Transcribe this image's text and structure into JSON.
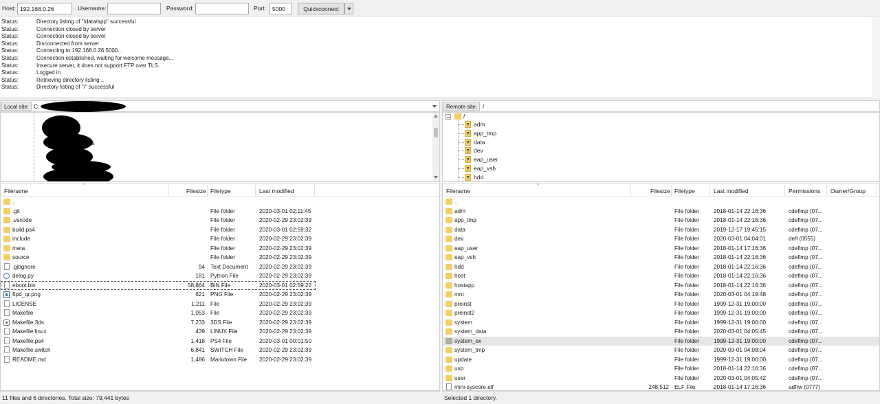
{
  "quickconnect": {
    "host_label": "Host:",
    "host_value": "192.168.0.26",
    "username_label": "Username:",
    "username_value": "",
    "password_label": "Password:",
    "password_value": "",
    "port_label": "Port:",
    "port_value": "5000",
    "button_label": "Quickconnect"
  },
  "log": [
    {
      "kind": "Status:",
      "msg": "Directory listing of \"/data/app\" successful"
    },
    {
      "kind": "Status:",
      "msg": "Connection closed by server"
    },
    {
      "kind": "Status:",
      "msg": "Connection closed by server"
    },
    {
      "kind": "Status:",
      "msg": "Disconnected from server"
    },
    {
      "kind": "Status:",
      "msg": "Connecting to 192.168.0.26:5000..."
    },
    {
      "kind": "Status:",
      "msg": "Connection established, waiting for welcome message..."
    },
    {
      "kind": "Status:",
      "msg": "Insecure server, it does not support FTP over TLS."
    },
    {
      "kind": "Status:",
      "msg": "Logged in"
    },
    {
      "kind": "Status:",
      "msg": "Retrieving directory listing..."
    },
    {
      "kind": "Status:",
      "msg": "Directory listing of \"/\" successful"
    }
  ],
  "local": {
    "site_label": "Local site:",
    "site_path": "C:",
    "tree_visible_text": "a",
    "columns": {
      "filename": "Filename",
      "filesize": "Filesize",
      "filetype": "Filetype",
      "modified": "Last modified"
    },
    "files": [
      {
        "name": "..",
        "size": "",
        "type": "",
        "modified": "",
        "icon": "folder"
      },
      {
        "name": ".git",
        "size": "",
        "type": "File folder",
        "modified": "2020-03-01 02:11:45",
        "icon": "folder"
      },
      {
        "name": ".vscode",
        "size": "",
        "type": "File folder",
        "modified": "2020-02-29 23:02:39",
        "icon": "folder"
      },
      {
        "name": "build.ps4",
        "size": "",
        "type": "File folder",
        "modified": "2020-03-01 02:59:32",
        "icon": "folder"
      },
      {
        "name": "include",
        "size": "",
        "type": "File folder",
        "modified": "2020-02-29 23:02:39",
        "icon": "folder"
      },
      {
        "name": "meta",
        "size": "",
        "type": "File folder",
        "modified": "2020-02-29 23:02:39",
        "icon": "folder"
      },
      {
        "name": "source",
        "size": "",
        "type": "File folder",
        "modified": "2020-02-29 23:02:39",
        "icon": "folder"
      },
      {
        "name": ".gitignore",
        "size": "94",
        "type": "Text Document",
        "modified": "2020-02-29 23:02:39",
        "icon": "document"
      },
      {
        "name": "delog.py",
        "size": "181",
        "type": "Python File",
        "modified": "2020-02-29 23:02:39",
        "icon": "python"
      },
      {
        "name": "eboot.bin",
        "size": "58,864",
        "type": "BIN File",
        "modified": "2020-03-01 02:59:22",
        "icon": "document"
      },
      {
        "name": "ftpd_qr.png",
        "size": "621",
        "type": "PNG File",
        "modified": "2020-02-29 23:02:39",
        "icon": "image"
      },
      {
        "name": "LICENSE",
        "size": "1,211",
        "type": "File",
        "modified": "2020-02-29 23:02:39",
        "icon": "document"
      },
      {
        "name": "Makefile",
        "size": "1,053",
        "type": "File",
        "modified": "2020-02-29 23:02:39",
        "icon": "document"
      },
      {
        "name": "Makefile.3ds",
        "size": "7,233",
        "type": "3DS File",
        "modified": "2020-02-29 23:02:39",
        "icon": "gear"
      },
      {
        "name": "Makefile.linux",
        "size": "439",
        "type": "LINUX File",
        "modified": "2020-02-29 23:02:39",
        "icon": "document"
      },
      {
        "name": "Makefile.ps4",
        "size": "1,418",
        "type": "PS4 File",
        "modified": "2020-03-01 00:01:50",
        "icon": "document"
      },
      {
        "name": "Makefile.switch",
        "size": "6,841",
        "type": "SWITCH File",
        "modified": "2020-02-29 23:02:39",
        "icon": "document"
      },
      {
        "name": "README.md",
        "size": "1,486",
        "type": "Markdown File",
        "modified": "2020-02-29 23:02:39",
        "icon": "document"
      }
    ],
    "status": "11 files and 6 directories. Total size: 79,441 bytes"
  },
  "remote": {
    "site_label": "Remote site:",
    "site_path": "/",
    "tree_root": "/",
    "tree_items": [
      "adm",
      "app_tmp",
      "data",
      "dev",
      "eap_user",
      "eap_vsh",
      "hdd"
    ],
    "columns": {
      "filename": "Filename",
      "filesize": "Filesize",
      "filetype": "Filetype",
      "modified": "Last modified",
      "permissions": "Permissions",
      "owner": "Owner/Group"
    },
    "files": [
      {
        "name": "..",
        "size": "",
        "type": "",
        "modified": "",
        "perms": "",
        "icon": "folder"
      },
      {
        "name": "adm",
        "size": "",
        "type": "File folder",
        "modified": "2018-01-14 22:16:36",
        "perms": "cdeflmp (07...",
        "icon": "folder"
      },
      {
        "name": "app_tmp",
        "size": "",
        "type": "File folder",
        "modified": "2018-01-14 22:16:36",
        "perms": "cdeflmp (07...",
        "icon": "folder"
      },
      {
        "name": "data",
        "size": "",
        "type": "File folder",
        "modified": "2019-12-17 19:45:15",
        "perms": "cdeflmp (07...",
        "icon": "folder"
      },
      {
        "name": "dev",
        "size": "",
        "type": "File folder",
        "modified": "2020-03-01 04:04:01",
        "perms": "defl (0555)",
        "icon": "folder"
      },
      {
        "name": "eap_user",
        "size": "",
        "type": "File folder",
        "modified": "2018-01-14 17:16:36",
        "perms": "cdeflmp (07...",
        "icon": "folder"
      },
      {
        "name": "eap_vsh",
        "size": "",
        "type": "File folder",
        "modified": "2018-01-14 22:16:36",
        "perms": "cdeflmp (07...",
        "icon": "folder"
      },
      {
        "name": "hdd",
        "size": "",
        "type": "File folder",
        "modified": "2018-01-14 22:16:36",
        "perms": "cdeflmp (07...",
        "icon": "folder"
      },
      {
        "name": "host",
        "size": "",
        "type": "File folder",
        "modified": "2018-01-14 22:16:36",
        "perms": "cdeflmp (07...",
        "icon": "folder"
      },
      {
        "name": "hostapp",
        "size": "",
        "type": "File folder",
        "modified": "2018-01-14 22:16:36",
        "perms": "cdeflmp (07...",
        "icon": "folder"
      },
      {
        "name": "mnt",
        "size": "",
        "type": "File folder",
        "modified": "2020-03-01 04:19:48",
        "perms": "cdeflmp (07...",
        "icon": "folder"
      },
      {
        "name": "preinst",
        "size": "",
        "type": "File folder",
        "modified": "1999-12-31 19:00:00",
        "perms": "cdeflmp (07...",
        "icon": "folder"
      },
      {
        "name": "preinst2",
        "size": "",
        "type": "File folder",
        "modified": "1999-12-31 19:00:00",
        "perms": "cdeflmp (07...",
        "icon": "folder"
      },
      {
        "name": "system",
        "size": "",
        "type": "File folder",
        "modified": "1999-12-31 19:00:00",
        "perms": "cdeflmp (07...",
        "icon": "folder"
      },
      {
        "name": "system_data",
        "size": "",
        "type": "File folder",
        "modified": "2020-03-01 04:05:45",
        "perms": "cdeflmp (07...",
        "icon": "folder"
      },
      {
        "name": "system_ex",
        "size": "",
        "type": "File folder",
        "modified": "1999-12-31 19:00:00",
        "perms": "cdeflmp (07...",
        "icon": "folder-selected",
        "selected": true
      },
      {
        "name": "system_tmp",
        "size": "",
        "type": "File folder",
        "modified": "2020-03-01 04:08:04",
        "perms": "cdeflmp (07...",
        "icon": "folder"
      },
      {
        "name": "update",
        "size": "",
        "type": "File folder",
        "modified": "1999-12-31 19:00:00",
        "perms": "cdeflmp (07...",
        "icon": "folder"
      },
      {
        "name": "usb",
        "size": "",
        "type": "File folder",
        "modified": "2018-01-14 22:16:36",
        "perms": "cdeflmp (07...",
        "icon": "folder"
      },
      {
        "name": "user",
        "size": "",
        "type": "File folder",
        "modified": "2020-03-01 04:05:42",
        "perms": "cdeflmp (07...",
        "icon": "folder"
      },
      {
        "name": "mini-syscore.elf",
        "size": "248,512",
        "type": "ELF File",
        "modified": "2018-01-14 17:16:36",
        "perms": "adfrw (0777)",
        "icon": "document"
      }
    ],
    "status": "Selected 1 directory."
  }
}
